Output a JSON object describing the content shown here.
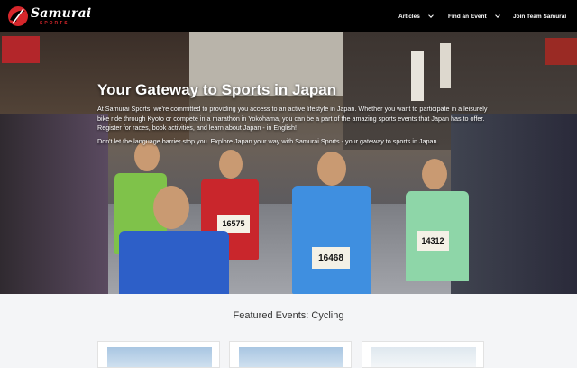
{
  "brand": {
    "name": "Samurai",
    "subtitle": "SPORTS",
    "accent": "#d6262b"
  },
  "nav": {
    "items": [
      {
        "label": "Articles",
        "icon": "chevron-down-icon"
      },
      {
        "label": "Find an Event",
        "icon": "chevron-down-icon"
      },
      {
        "label": "Join Team Samurai"
      }
    ]
  },
  "hero": {
    "title": "Your Gateway to Sports in Japan",
    "paragraph1": "At Samurai Sports, we're committed to providing you access to an active lifestyle in Japan. Whether you want to participate in a leisurely bike ride through Kyoto or compete in a marathon in Yokohama, you can be a part of the amazing sports events that Japan has to offer. Register for races, book activities, and learn about Japan - in English!",
    "paragraph2": "Don't let the language barrier stop you. Explore Japan your way with Samurai Sports - your gateway to sports in Japan.",
    "bibs": [
      "16575",
      "16468",
      "14312"
    ]
  },
  "featured": {
    "title": "Featured Events: Cycling"
  }
}
